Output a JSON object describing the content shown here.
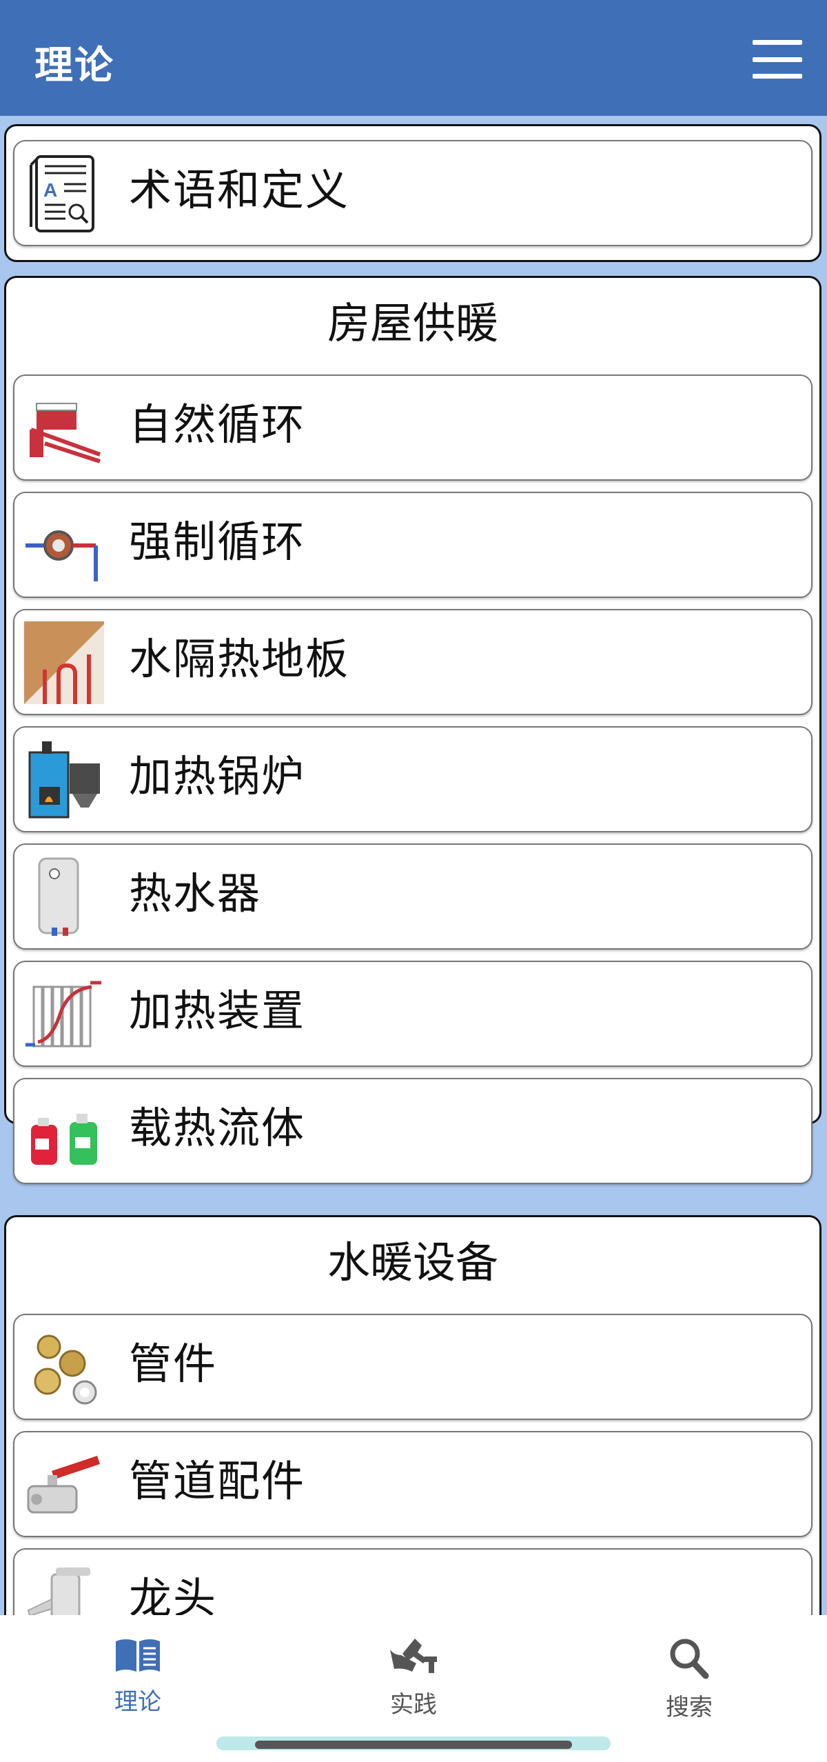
{
  "header": {
    "title": "理论",
    "menu_icon": "hamburger-menu-icon"
  },
  "glossary": {
    "label": "术语和定义",
    "icon": "glossary-book-icon"
  },
  "sections": [
    {
      "heading": "房屋供暖",
      "items": [
        {
          "label": "自然循环",
          "icon": "natural-circulation-icon"
        },
        {
          "label": "强制循环",
          "icon": "circulation-pump-icon"
        },
        {
          "label": "水隔热地板",
          "icon": "underfloor-heating-icon"
        },
        {
          "label": "加热锅炉",
          "icon": "boiler-icon"
        },
        {
          "label": "热水器",
          "icon": "water-heater-icon"
        },
        {
          "label": "加热装置",
          "icon": "radiator-icon"
        },
        {
          "label": "载热流体",
          "icon": "coolant-bottles-icon"
        }
      ]
    },
    {
      "heading": "水暖设备",
      "items": [
        {
          "label": "管件",
          "icon": "pipe-fittings-icon"
        },
        {
          "label": "管道配件",
          "icon": "ball-valve-icon"
        },
        {
          "label": "龙头",
          "icon": "faucet-icon"
        }
      ]
    }
  ],
  "bottom_nav": [
    {
      "label": "理论",
      "icon": "book-icon",
      "active": true
    },
    {
      "label": "实践",
      "icon": "plumbing-tools-icon",
      "active": false
    },
    {
      "label": "搜索",
      "icon": "search-icon",
      "active": false
    }
  ],
  "colors": {
    "primary": "#3f6fb6",
    "background": "#a9c7ee"
  }
}
